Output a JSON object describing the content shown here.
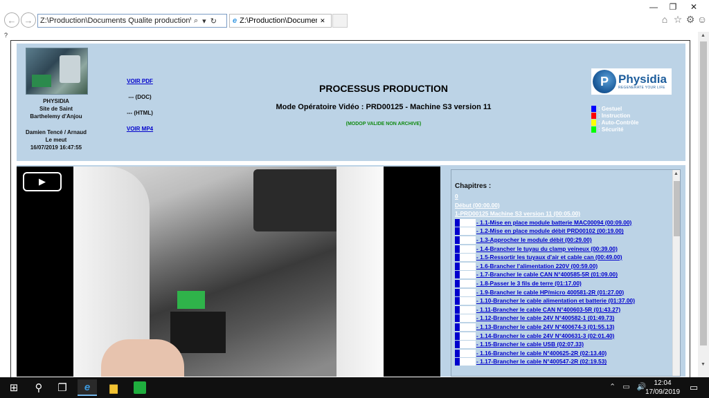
{
  "browser": {
    "address": "Z:\\Production\\Documents Qualite production\\Docum",
    "address_tools": [
      "⌕",
      "▾",
      "↻"
    ],
    "tab_title": "Z:\\Production\\Documents ...",
    "window_buttons": [
      "—",
      "❐",
      "✕"
    ],
    "toolbar_icons": [
      "home-icon",
      "star-icon",
      "gear-icon",
      "smile-icon"
    ]
  },
  "page_marker": "?",
  "header": {
    "company": [
      "PHYSIDIA",
      "Site de Saint",
      "Barthelemy d'Anjou"
    ],
    "author": [
      "Damien Tencé / Arnaud",
      "Le meut",
      "16/07/2019 16:47:55"
    ],
    "links": {
      "pdf": "VOIR PDF",
      "doc": "--- (DOC)",
      "html": "--- (HTML)",
      "mp4": "VOIR MP4"
    },
    "title": "PROCESSUS PRODUCTION",
    "subtitle": "Mode Opératoire Vidéo : PRD00125 - Machine S3 version 11",
    "status": "(MODOP VALIDE NON ARCHIVE)",
    "brand": {
      "name": "Physidia",
      "tagline": "REGENERATE YOUR LIFE"
    },
    "legend": [
      {
        "label": ": Gestuel",
        "color": "#0000ff"
      },
      {
        "label": ": Instruction",
        "color": "#ff0000"
      },
      {
        "label": ": Auto-Contrôle",
        "color": "#ffff00"
      },
      {
        "label": ": Sécurité",
        "color": "#00ff00"
      }
    ]
  },
  "video": {
    "play_label": "▶"
  },
  "chapters": {
    "title": "Chapitres :",
    "items": [
      {
        "label": "0",
        "marker": false
      },
      {
        "label": "Début (00:00.00)",
        "marker": false
      },
      {
        "label": "1-PRD00125 Machine S3 version 11 (00:05.00)",
        "marker": false
      },
      {
        "label": "- 1.1-Mise en place module batterie MAC00094 (00:09.00)",
        "marker": true
      },
      {
        "label": "- 1.2-Mise en place module débit PRD00102 (00:19.00)",
        "marker": true
      },
      {
        "label": "- 1.3-Approcher le module débit (00:29.00)",
        "marker": true
      },
      {
        "label": "- 1.4-Brancher le tuyau du clamp veineux (00:39.00)",
        "marker": true
      },
      {
        "label": "- 1.5-Ressortir les tuyaux d'air et cable can (00:49.00)",
        "marker": true
      },
      {
        "label": "- 1.6-Brancher l'alimentation 220V (00:59.00)",
        "marker": true
      },
      {
        "label": "- 1.7-Brancher le cable CAN N°400585-5R (01:09.00)",
        "marker": true
      },
      {
        "label": "- 1.8-Passer le 3 fils de terre (01:17.00)",
        "marker": true
      },
      {
        "label": "- 1.9-Brancher le cable HP/micro 400581-2R (01:27.00)",
        "marker": true
      },
      {
        "label": "- 1.10-Brancher le cable alimentation et batterie (01:37.00)",
        "marker": true
      },
      {
        "label": "- 1.11-Brancher le cable CAN N°400603-5R (01:43.27)",
        "marker": true
      },
      {
        "label": "- 1.12-Brancher le cable 24V N°400582-1 (01:49.73)",
        "marker": true
      },
      {
        "label": "- 1.13-Brancher le cable 24V N°400674-3 (01:55.13)",
        "marker": true
      },
      {
        "label": "- 1.14-Brancher le cable 24V N°400631-3 (02:01.40)",
        "marker": true
      },
      {
        "label": "- 1.15-Brancher le cable USB (02:07.33)",
        "marker": true
      },
      {
        "label": "- 1.16-Brancher le cable N°400625-2R (02:13.40)",
        "marker": true
      },
      {
        "label": "- 1.17-Brancher le cable N°400547-2R (02:19.53)",
        "marker": true
      }
    ]
  },
  "taskbar": {
    "time": "12:04",
    "date": "17/09/2019",
    "tray": [
      "⌃",
      "▭",
      "🔊"
    ]
  }
}
